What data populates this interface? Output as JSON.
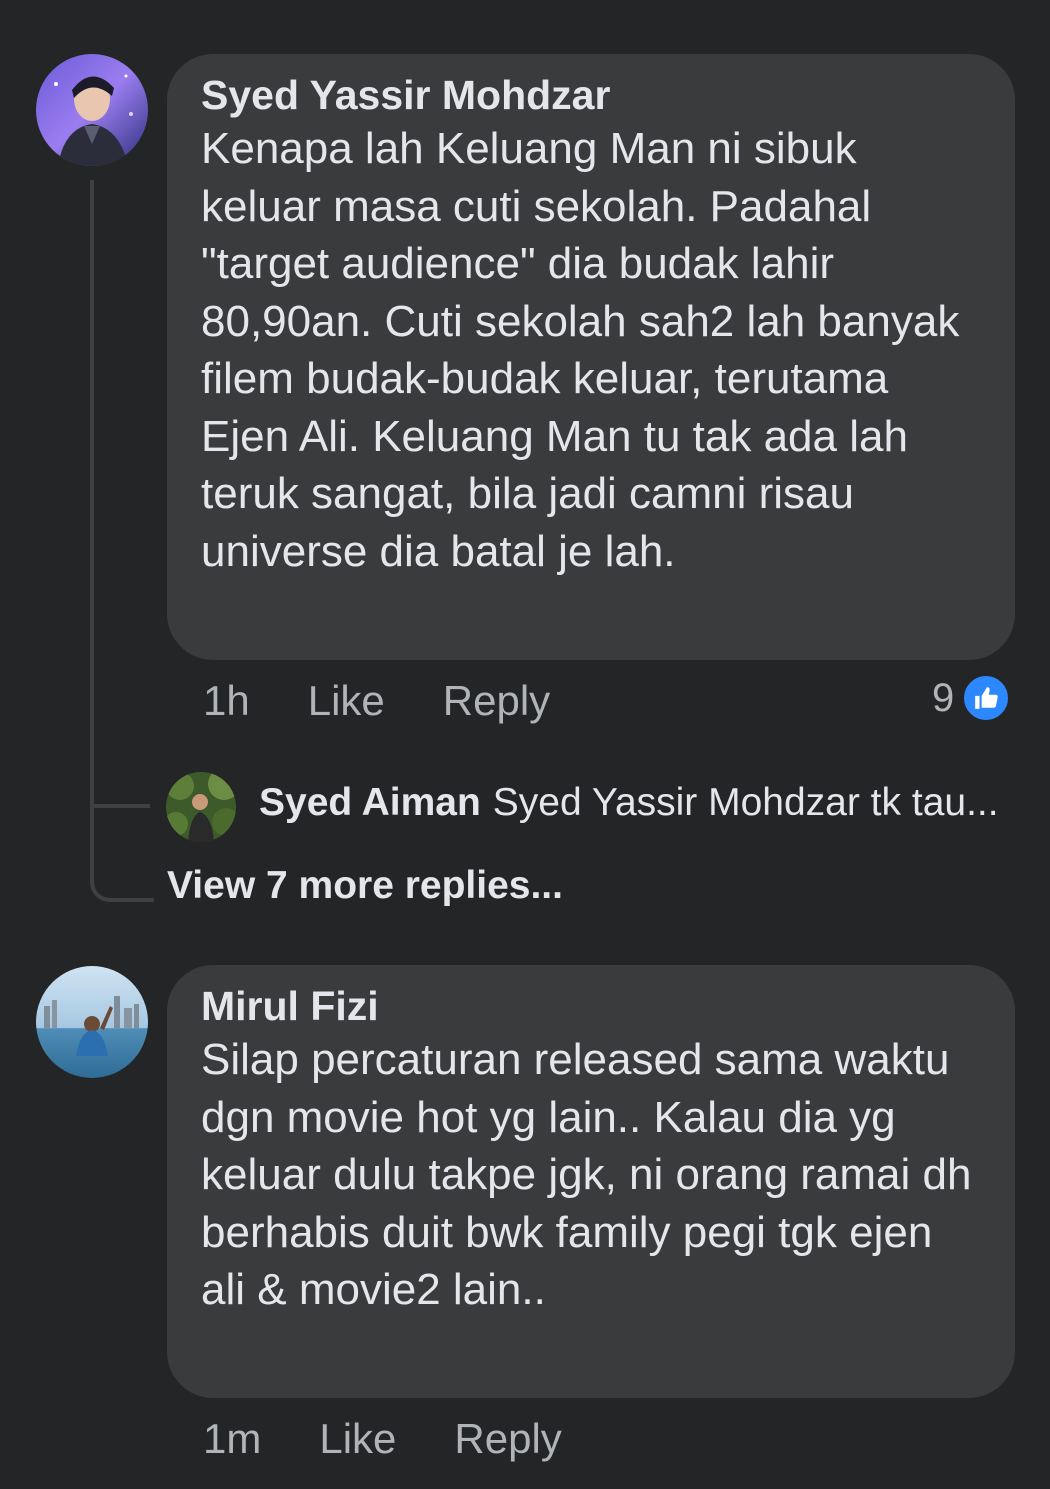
{
  "comments": [
    {
      "author": "Syed Yassir Mohdzar",
      "text": "Kenapa lah Keluang Man ni sibuk keluar masa cuti sekolah. Padahal \"target audience\" dia budak lahir 80,90an. Cuti sekolah sah2 lah banyak filem budak-budak keluar, terutama Ejen Ali. Keluang Man tu tak ada lah teruk sangat, bila jadi camni risau universe dia batal je lah.",
      "time": "1h",
      "like_label": "Like",
      "reply_label": "Reply",
      "reaction_count": "9",
      "reaction_icon": "thumbs-up-icon",
      "reply_preview": {
        "author": "Syed Aiman",
        "snippet": "Syed Yassir Mohdzar tk tau..."
      },
      "view_more": "View 7 more replies..."
    },
    {
      "author": "Mirul Fizi",
      "text": "Silap percaturan released sama waktu dgn movie hot yg lain.. Kalau dia yg keluar dulu takpe jgk, ni orang ramai dh berhabis duit bwk family pegi tgk ejen ali & movie2 lain..",
      "time": "1m",
      "like_label": "Like",
      "reply_label": "Reply"
    }
  ],
  "colors": {
    "background": "#242526",
    "bubble": "#3a3b3c",
    "text": "#e4e6eb",
    "secondary_text": "#b0b3b8",
    "like_blue": "#2d88ff"
  }
}
